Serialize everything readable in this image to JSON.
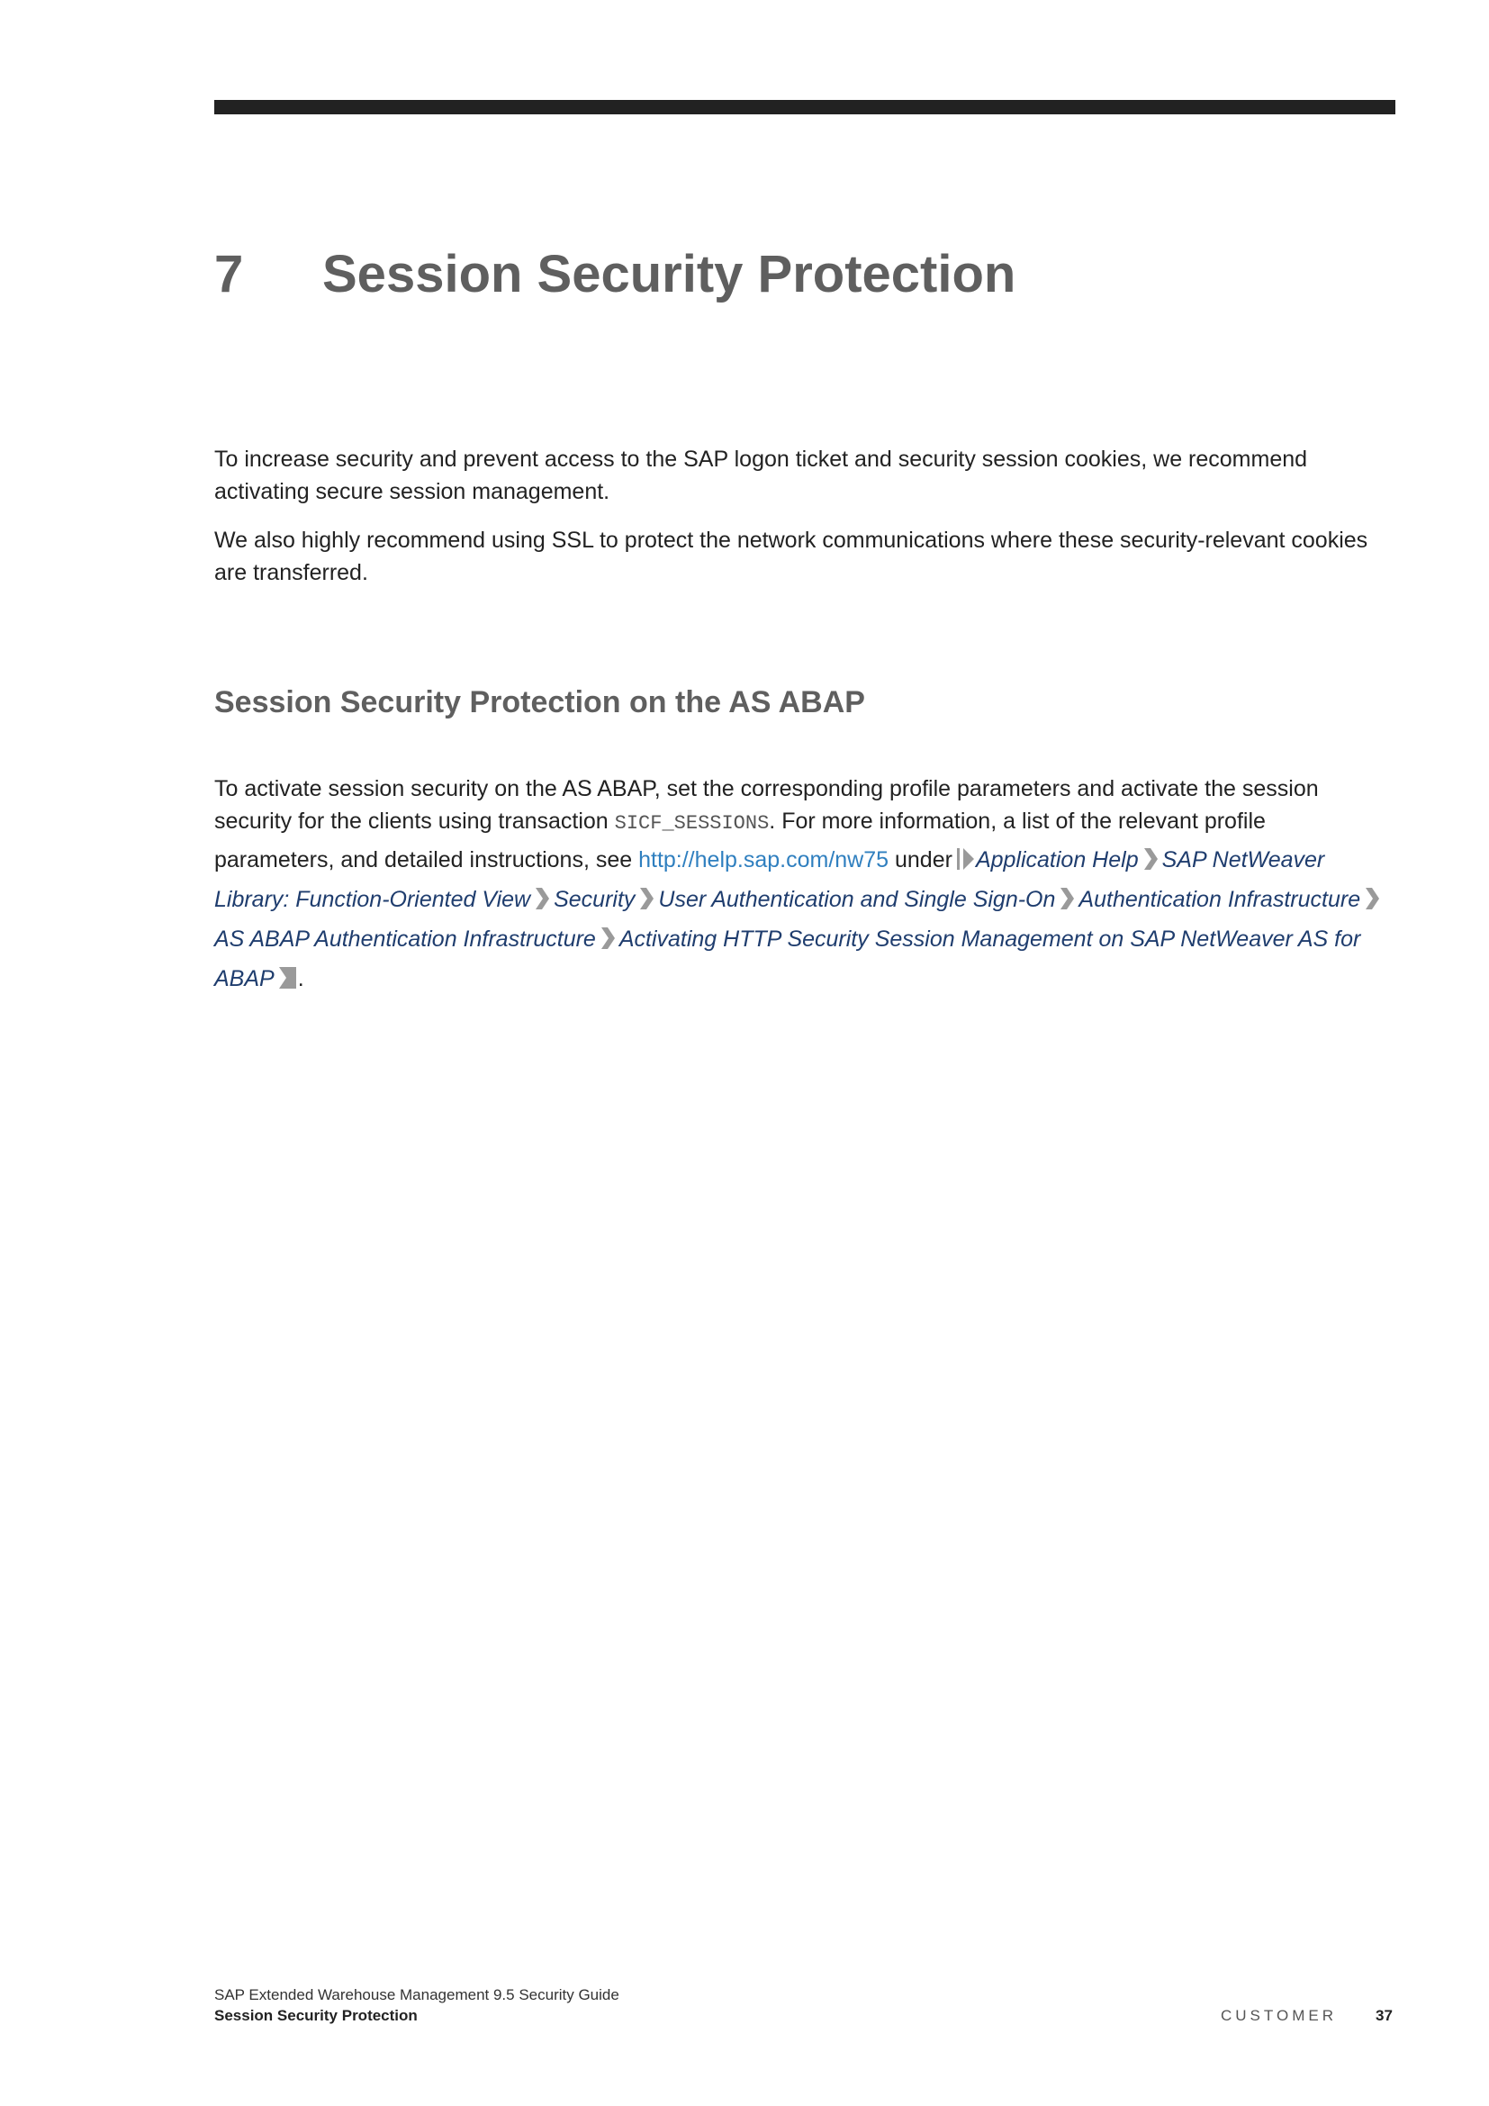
{
  "chapter": {
    "number": "7",
    "title": "Session Security Protection"
  },
  "intro": {
    "p1": "To increase security and prevent access to the SAP logon ticket and security session cookies, we recommend activating secure session management.",
    "p2": "We also highly recommend using SSL to protect the network communications where these security-relevant cookies are transferred."
  },
  "section": {
    "title": "Session Security Protection on the AS ABAP",
    "body_line1": "To activate session security on the AS ABAP, set the corresponding profile parameters and activate the session",
    "body_line2_a": "security for the clients using transaction ",
    "body_code": "SICF_SESSIONS",
    "body_line2_b": ". For more information, a list of the relevant profile",
    "body_line3_a": "parameters, and detailed instructions, see ",
    "link": "http://help.sap.com/nw75",
    "under": " under",
    "path": [
      "Application Help",
      "SAP NetWeaver Library: Function-Oriented View",
      "Security",
      "User Authentication and Single Sign-On",
      "Authentication Infrastructure",
      "AS ABAP Authentication Infrastructure",
      "Activating HTTP Security Session Management on SAP NetWeaver AS for ABAP"
    ],
    "end": "."
  },
  "footer": {
    "doc_title": "SAP Extended Warehouse Management 9.5 Security Guide",
    "section": "Session Security Protection",
    "classification": "CUSTOMER",
    "page": "37"
  },
  "colors": {
    "heading": "#5f5f5f",
    "link": "#2f7fbf",
    "path": "#1f3d6e",
    "chevron": "#9a9a9a"
  }
}
